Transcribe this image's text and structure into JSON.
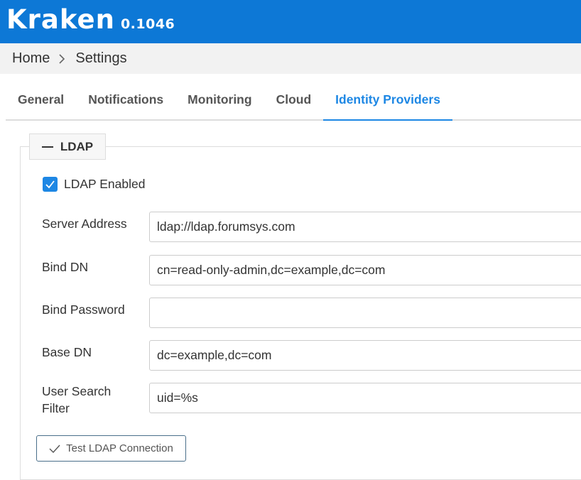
{
  "app": {
    "name": "Kraken",
    "version": "0.1046"
  },
  "breadcrumb": {
    "home": "Home",
    "current": "Settings"
  },
  "tabs": [
    {
      "label": "General",
      "active": false
    },
    {
      "label": "Notifications",
      "active": false
    },
    {
      "label": "Monitoring",
      "active": false
    },
    {
      "label": "Cloud",
      "active": false
    },
    {
      "label": "Identity Providers",
      "active": true
    }
  ],
  "ldap": {
    "section_title": "LDAP",
    "enabled_label": "LDAP Enabled",
    "enabled": true,
    "fields": {
      "server_address": {
        "label": "Server Address",
        "value": "ldap://ldap.forumsys.com"
      },
      "bind_dn": {
        "label": "Bind DN",
        "value": "cn=read-only-admin,dc=example,dc=com"
      },
      "bind_password": {
        "label": "Bind Password",
        "value": ""
      },
      "base_dn": {
        "label": "Base DN",
        "value": "dc=example,dc=com"
      },
      "user_search_filter": {
        "label": "User Search Filter",
        "value": "uid=%s"
      }
    },
    "test_button_label": "Test LDAP Connection"
  },
  "colors": {
    "header_bg": "#0d78d6",
    "accent": "#1d87e4",
    "breadcrumb_bg": "#f2f2f2"
  }
}
